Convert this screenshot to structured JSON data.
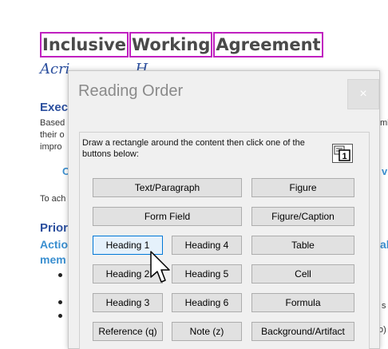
{
  "document": {
    "title_words": [
      "Inclusive",
      "Working",
      "Agreement"
    ],
    "subtitle": "Acri",
    "subtitle_tail": "H",
    "section1": "Exec",
    "para1_line1": "Based",
    "para1_line2": "their o",
    "para1_line3": "impro",
    "link_c": "C",
    "para2": "To ach",
    "section2": "Prior",
    "section3_a": "Actio",
    "section3_b": "mem",
    "right_fragments": {
      "r1": "mb",
      "r2": "v",
      "r3": "al",
      "r4": "s",
      "r5": "o)"
    }
  },
  "dialog": {
    "title": "Reading Order",
    "close_label": "×",
    "instructions": "Draw a rectangle around the content then click one of the buttons below:",
    "icon_label": "1",
    "buttons": {
      "text_paragraph": "Text/Paragraph",
      "figure": "Figure",
      "form_field": "Form Field",
      "figure_caption": "Figure/Caption",
      "heading1": "Heading 1",
      "heading4": "Heading 4",
      "table": "Table",
      "heading2": "Heading 2",
      "heading5": "Heading 5",
      "cell": "Cell",
      "heading3": "Heading 3",
      "heading6": "Heading 6",
      "formula": "Formula",
      "reference": "Reference (q)",
      "note": "Note (z)",
      "background": "Background/Artifact"
    }
  },
  "colors": {
    "tag_outline": "#c020c0",
    "heading_blue": "#2b4f9e",
    "link_blue": "#3a8fd0",
    "focus_blue": "#0078d7"
  }
}
